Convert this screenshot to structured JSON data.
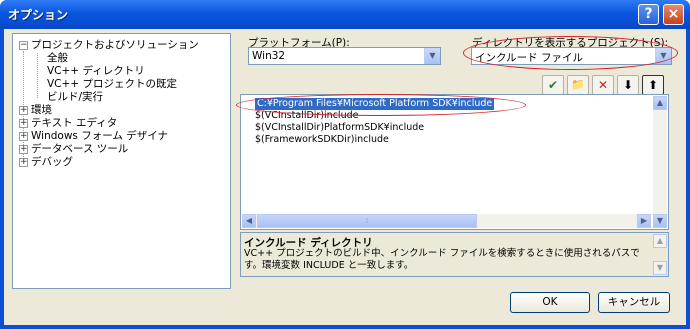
{
  "window": {
    "title": "オプション",
    "help_glyph": "?",
    "close_glyph": "×"
  },
  "tree": {
    "items": [
      {
        "label": "プロジェクトおよびソリューション",
        "expander": "−"
      },
      {
        "label": "全般"
      },
      {
        "label": "VC++ ディレクトリ",
        "selected": true
      },
      {
        "label": "VC++ プロジェクトの既定"
      },
      {
        "label": "ビルド/実行"
      },
      {
        "label": "環境",
        "expander": "+"
      },
      {
        "label": "テキスト エディタ",
        "expander": "+"
      },
      {
        "label": "Windows フォーム デザイナ",
        "expander": "+"
      },
      {
        "label": "データベース ツール",
        "expander": "+"
      },
      {
        "label": "デバッグ",
        "expander": "+"
      }
    ]
  },
  "platform": {
    "label": "プラットフォーム(P):",
    "value": "Win32"
  },
  "dirs_for": {
    "label": "ディレクトリを表示するプロジェクト(S):",
    "value": "インクルード ファイル"
  },
  "toolbar": {
    "check": "✔",
    "new_folder": "📁",
    "delete": "✕",
    "down": "⬇",
    "up": "⬆"
  },
  "paths": [
    "C:¥Program Files¥Microsoft Platform SDK¥include",
    "$(VCInstallDir)include",
    "$(VCInstallDir)PlatformSDK¥include",
    "$(FrameworkSDKDir)include"
  ],
  "description": {
    "title": "インクルード ディレクトリ",
    "body": "VC++ プロジェクトのビルド中、インクルード ファイルを検索するときに使用されるパスです。環境変数 INCLUDE と一致します。"
  },
  "buttons": {
    "ok": "OK",
    "cancel": "キャンセル"
  },
  "colors": {
    "title_bar": "#0a57e0",
    "selection": "#316ac5",
    "annotation": "#d4202a"
  }
}
